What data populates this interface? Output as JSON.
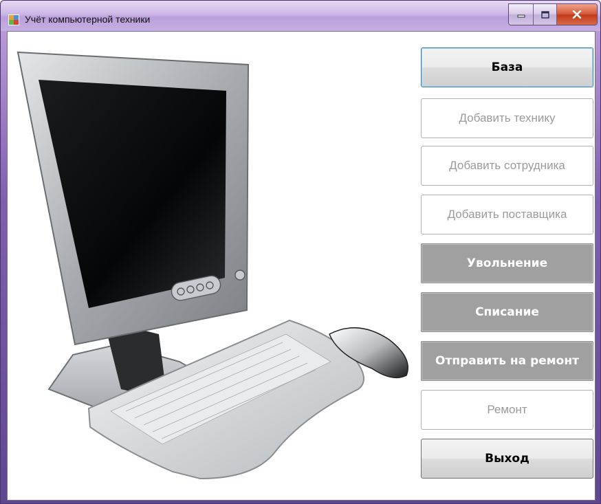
{
  "window": {
    "title": "Учёт компьютерной техники",
    "icons": {
      "app": "app-window-icon",
      "minimize": "minimize-icon",
      "maximize": "maximize-icon",
      "close": "close-icon"
    }
  },
  "illustration": {
    "name": "computer-monitor-keyboard-mouse-illustration"
  },
  "buttons": {
    "base": "База",
    "add_equipment": "Добавить технику",
    "add_employee": "Добавить сотрудника",
    "add_supplier": "Добавить поставщика",
    "dismissal": "Увольнение",
    "write_off": "Списание",
    "send_to_repair": "Отправить на ремонт",
    "repair": "Ремонт",
    "exit": "Выход"
  },
  "colors": {
    "titlebar": "#c7b0e3",
    "close_button": "#c8462a",
    "flat_button": "#a0a0a0",
    "disabled_text": "#9a9a9a",
    "focus_border": "#3c7fb1"
  }
}
